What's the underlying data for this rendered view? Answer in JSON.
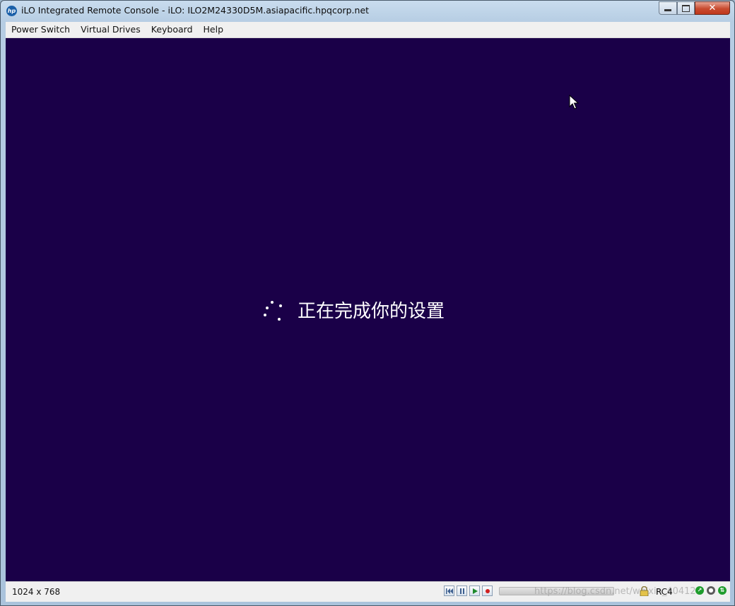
{
  "window": {
    "title": "iLO Integrated Remote Console - iLO: ILO2M24330D5M.asiapacific.hpqcorp.net",
    "app_icon": "hp-logo-icon",
    "controls": [
      "minimize-icon",
      "maximize-icon",
      "close-icon"
    ]
  },
  "menubar": {
    "items": [
      {
        "label": "Power Switch"
      },
      {
        "label": "Virtual Drives"
      },
      {
        "label": "Keyboard"
      },
      {
        "label": "Help"
      }
    ]
  },
  "console": {
    "background_color": "#1a0048",
    "status_text": "正在完成你的设置",
    "spinner_icon": "loading-dots-icon",
    "cursor_icon": "mouse-pointer-icon"
  },
  "statusbar": {
    "resolution": "1024 x 768",
    "playback_buttons": [
      "rewind-icon",
      "pause-icon",
      "play-icon",
      "record-icon"
    ],
    "watermark": "https://blog.csdn.net/weixin_40412",
    "lock_icon": "padlock-icon",
    "encryption": "RC4",
    "leds": [
      {
        "icon": "led-green-icon",
        "color": "#1e9c2c"
      },
      {
        "icon": "led-gray-icon",
        "color": "#5a5a5a"
      },
      {
        "icon": "led-green-icon",
        "color": "#1e9c2c"
      }
    ]
  }
}
